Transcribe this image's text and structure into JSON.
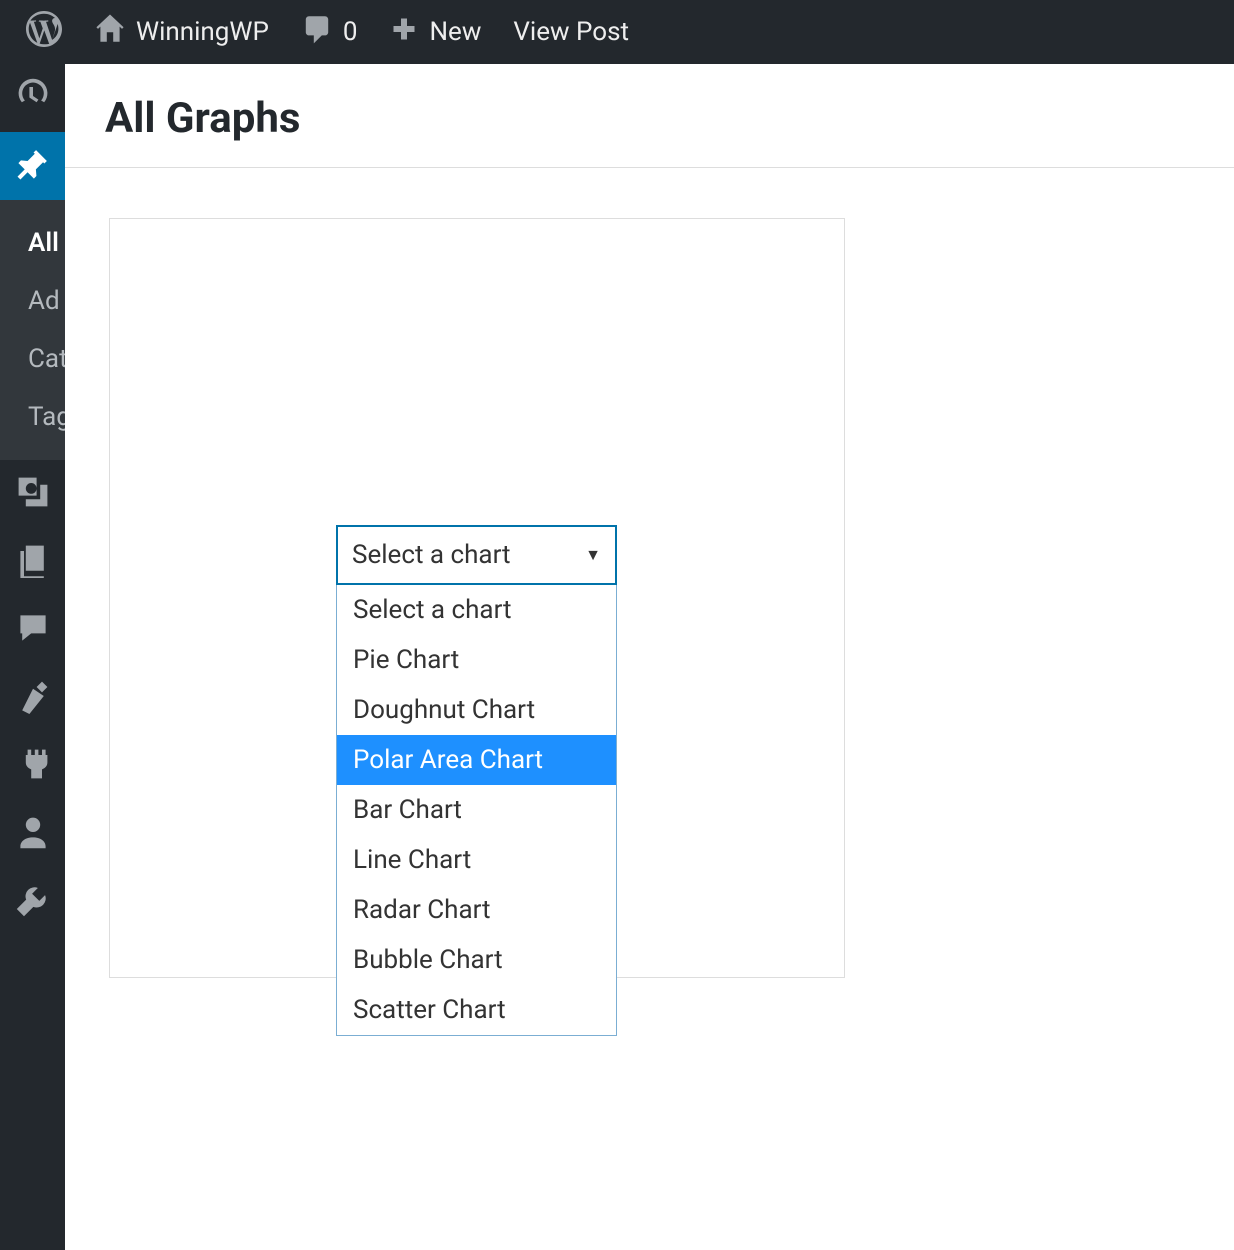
{
  "adminbar": {
    "site_name": "WinningWP",
    "comment_count": "0",
    "new_label": "New",
    "view_post_label": "View Post"
  },
  "sidebar": {
    "submenu": {
      "items": [
        {
          "label": "All",
          "current": true
        },
        {
          "label": "Ad",
          "current": false
        },
        {
          "label": "Cat",
          "current": false
        },
        {
          "label": "Tag",
          "current": false
        }
      ]
    }
  },
  "page": {
    "title": "All Graphs"
  },
  "select": {
    "selected": "Select a chart",
    "options": [
      {
        "label": "Select a chart",
        "highlighted": false
      },
      {
        "label": "Pie Chart",
        "highlighted": false
      },
      {
        "label": "Doughnut Chart",
        "highlighted": false
      },
      {
        "label": "Polar Area Chart",
        "highlighted": true
      },
      {
        "label": "Bar Chart",
        "highlighted": false
      },
      {
        "label": "Line Chart",
        "highlighted": false
      },
      {
        "label": "Radar Chart",
        "highlighted": false
      },
      {
        "label": "Bubble Chart",
        "highlighted": false
      },
      {
        "label": "Scatter Chart",
        "highlighted": false
      }
    ]
  }
}
